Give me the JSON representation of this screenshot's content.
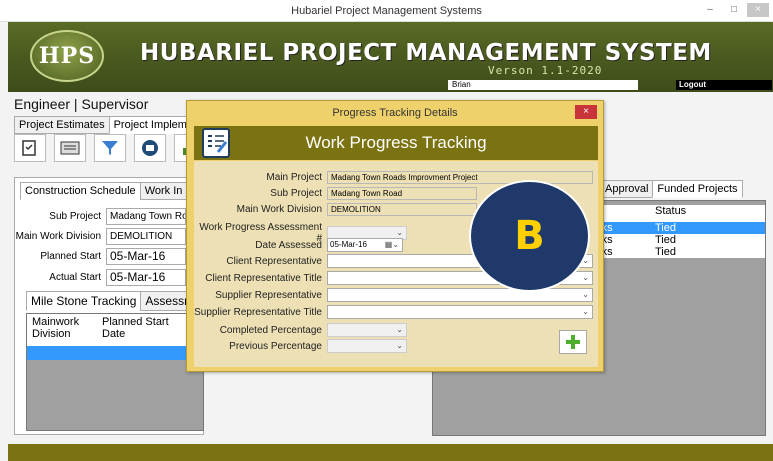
{
  "window": {
    "title": "Hubariel Project Management Systems",
    "minimize": "–",
    "maximize": "□",
    "close": "×"
  },
  "banner": {
    "logo_text": "HPS",
    "title": "HUBARIEL PROJECT MANAGEMENT SYSTEM",
    "version": "Verson 1.1-2020",
    "user": "Brian",
    "logout": "Logout"
  },
  "role": "Engineer | Supervisor",
  "main_tabs": [
    "Project Estimates",
    "Project Implemen"
  ],
  "toolbar": [
    "checklist-icon",
    "keyboard-icon",
    "filter-icon",
    "money-icon",
    "chart-icon"
  ],
  "sub_tabs": [
    "Construction Schedule",
    "Work In Pr"
  ],
  "left_fields": {
    "sub_project_label": "Sub Project",
    "sub_project_value": "Madang Town Ro",
    "main_division_label": "Main Work Division",
    "main_division_value": "DEMOLITION",
    "planned_start_label": "Planned Start",
    "planned_start_value": "05-Mar-16",
    "actual_start_label": "Actual Start",
    "actual_start_value": "05-Mar-16"
  },
  "milestone_tabs": [
    "Mile Stone Tracking",
    "Assessment"
  ],
  "milestone_grid": {
    "col1": "Mainwork Division",
    "col2": "Planned Start Date"
  },
  "right_tabs": [
    "Approval",
    "Funded Projects"
  ],
  "right_grid": {
    "col1": "e",
    "col2": "Status",
    "rows": [
      {
        "c1": "rks",
        "c2": "Tied"
      },
      {
        "c1": "rks",
        "c2": "Tied"
      },
      {
        "c1": "rks",
        "c2": "Tied"
      }
    ]
  },
  "dialog": {
    "title": "Progress Tracking Details",
    "close": "×",
    "header": "Work Progress Tracking",
    "main_project_label": "Main Project",
    "main_project_value": "Madang Town Roads Improvment Project",
    "sub_project_label": "Sub Project",
    "sub_project_value": "Madang Town Road",
    "main_division_label": "Main Work Division",
    "main_division_value": "DEMOLITION",
    "assessment_label": "Work Progress Assessment #",
    "date_label": "Date Assessed",
    "date_value": "05-Mar-16",
    "client_rep_label": "Client Representative",
    "client_rep_title_label": "Client Representative Title",
    "supplier_rep_label": "Supplier Representative",
    "supplier_rep_title_label": "Supplier Representative Title",
    "completed_label": "Completed Percentage",
    "previous_label": "Previous Percentage",
    "add_button": "+"
  },
  "badge": "B"
}
